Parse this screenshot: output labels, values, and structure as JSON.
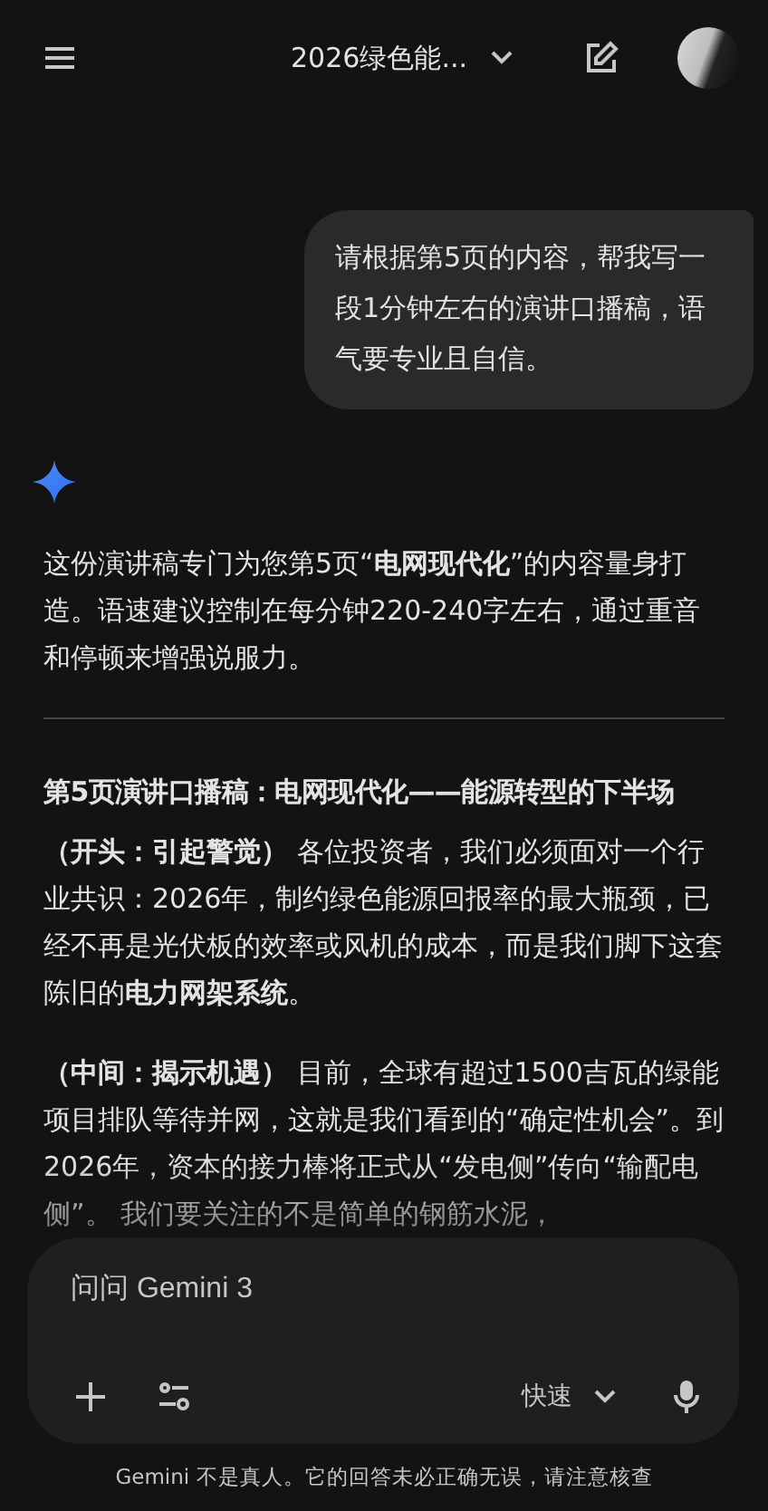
{
  "header": {
    "title": "2026绿色能..."
  },
  "user_message": "请根据第5页的内容，帮我写一段1分钟左右的演讲口播稿，语气要专业且自信。",
  "response": {
    "intro": "这份演讲稿专门为您第5页“**电网现代化**”的内容量身打造。语速建议控制在每分钟220-240字左右，通过重音和停顿来增强说服力。",
    "heading": "第5页演讲口播稿：电网现代化——能源转型的下半场",
    "paragraphs": [
      "**（开头：引起警觉）** 各位投资者，我们必须面对一个行业共识：2026年，制约绿色能源回报率的最大瓶颈，已经不再是光伏板的效率或风机的成本，而是我们脚下这套陈旧的**电力网架系统**。",
      "**（中间：揭示机遇）** 目前，全球有超过1500吉瓦的绿能项目排队等待并网，这就是我们看到的“确定性机会”。到2026年，资本的接力棒将正式从“发电侧”传向“输配电侧”。 我们要关注的不是简单的钢筋水泥，"
    ]
  },
  "composer": {
    "placeholder": "问问 Gemini 3",
    "mode": "快速"
  },
  "disclaimer": "Gemini 不是真人。它的回答未必正确无误，请注意核查"
}
